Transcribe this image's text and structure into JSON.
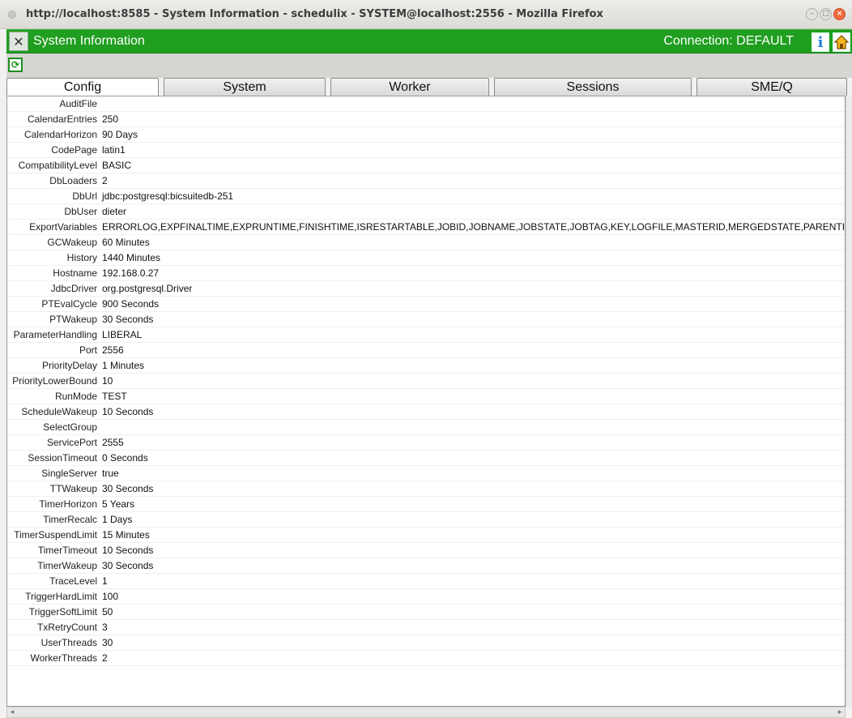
{
  "window": {
    "title": "http://localhost:8585 - System Information - schedulix - SYSTEM@localhost:2556 - Mozilla Firefox"
  },
  "app": {
    "title": "System Information",
    "connection": "Connection: DEFAULT",
    "accent": "#1f9e1f"
  },
  "tabs": [
    {
      "label": "Config",
      "active": true
    },
    {
      "label": "System",
      "active": false
    },
    {
      "label": "Worker",
      "active": false
    },
    {
      "label": "Sessions",
      "active": false
    },
    {
      "label": "SME/Q",
      "active": false
    }
  ],
  "config": [
    {
      "key": "AuditFile",
      "value": ""
    },
    {
      "key": "CalendarEntries",
      "value": "250"
    },
    {
      "key": "CalendarHorizon",
      "value": "90  Days"
    },
    {
      "key": "CodePage",
      "value": "latin1"
    },
    {
      "key": "CompatibilityLevel",
      "value": "BASIC"
    },
    {
      "key": "DbLoaders",
      "value": "2"
    },
    {
      "key": "DbUrl",
      "value": "jdbc:postgresql:bicsuitedb-251"
    },
    {
      "key": "DbUser",
      "value": "dieter"
    },
    {
      "key": "ExportVariables",
      "value": "ERRORLOG,EXPFINALTIME,EXPRUNTIME,FINISHTIME,ISRESTARTABLE,JOBID,JOBNAME,JOBSTATE,JOBTAG,KEY,LOGFILE,MASTERID,MERGEDSTATE,PARENTID,PID,RERUNSEQ,RESOURCETIME,RUNNABLETIME,SCOPENAME,SDMSHOST,SDMSPORT,SEID,STARTTIME,STATE,SUBMITTIME,SYNCTIME,SYSDATE,TRIGGERBASE,TRIGGERBASEID,TRIGGERBASEJOBID,TRIGGERNAME,TRIGGERNEWSTATE,TRIGGERORIGIN,TRIGGERORIGINID,TRIGGERORIGINJOBID,TRIGGEROLDSTATE,TRIGGERREASON,TRIGGERREASONID,TRIGGERREASONJOBID,TRIGGERSEQNO,TRIGGERTYPE,LAST_WARNING,WORKDIR"
    },
    {
      "key": "GCWakeup",
      "value": "60  Minutes"
    },
    {
      "key": "History",
      "value": "1440  Minutes"
    },
    {
      "key": "Hostname",
      "value": "192.168.0.27"
    },
    {
      "key": "JdbcDriver",
      "value": "org.postgresql.Driver"
    },
    {
      "key": "PTEvalCycle",
      "value": "900  Seconds"
    },
    {
      "key": "PTWakeup",
      "value": "30  Seconds"
    },
    {
      "key": "ParameterHandling",
      "value": "LIBERAL"
    },
    {
      "key": "Port",
      "value": "2556"
    },
    {
      "key": "PriorityDelay",
      "value": "1  Minutes"
    },
    {
      "key": "PriorityLowerBound",
      "value": "10"
    },
    {
      "key": "RunMode",
      "value": "TEST"
    },
    {
      "key": "ScheduleWakeup",
      "value": "10  Seconds"
    },
    {
      "key": "SelectGroup",
      "value": ""
    },
    {
      "key": "ServicePort",
      "value": "2555"
    },
    {
      "key": "SessionTimeout",
      "value": "0  Seconds"
    },
    {
      "key": "SingleServer",
      "value": "true"
    },
    {
      "key": "TTWakeup",
      "value": "30  Seconds"
    },
    {
      "key": "TimerHorizon",
      "value": "5  Years"
    },
    {
      "key": "TimerRecalc",
      "value": "1  Days"
    },
    {
      "key": "TimerSuspendLimit",
      "value": "15  Minutes"
    },
    {
      "key": "TimerTimeout",
      "value": "10  Seconds"
    },
    {
      "key": "TimerWakeup",
      "value": "30  Seconds"
    },
    {
      "key": "TraceLevel",
      "value": "1"
    },
    {
      "key": "TriggerHardLimit",
      "value": "100"
    },
    {
      "key": "TriggerSoftLimit",
      "value": "50"
    },
    {
      "key": "TxRetryCount",
      "value": "3"
    },
    {
      "key": "UserThreads",
      "value": "30"
    },
    {
      "key": "WorkerThreads",
      "value": "2"
    }
  ]
}
